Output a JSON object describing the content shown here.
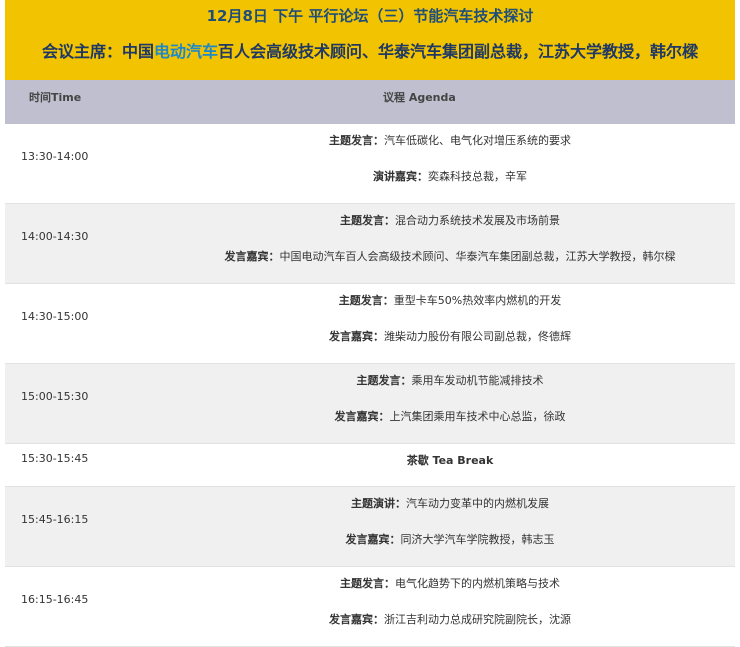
{
  "header": {
    "title": "12月8日 下午 平行论坛（三）节能汽车技术探讨",
    "chair_prefix": "会议主席：中国",
    "chair_highlight": "电动汽车",
    "chair_suffix": "百人会高级技术顾问、华泰汽车集团副总裁，江苏大学教授，韩尔樑"
  },
  "columns": {
    "time": "时间Time",
    "agenda": "议程 Agenda"
  },
  "sessions": [
    {
      "time": "13:30-14:00",
      "topic_label": "主题发言：",
      "topic": "汽车低碳化、电气化对增压系统的要求",
      "speaker_label": "演讲嘉宾：",
      "speaker": "奕森科技总裁，辛军"
    },
    {
      "time": "14:00-14:30",
      "topic_label": "主题发言：",
      "topic": "混合动力系统技术发展及市场前景",
      "speaker_label": "发言嘉宾：",
      "speaker": "中国电动汽车百人会高级技术顾问、华泰汽车集团副总裁，江苏大学教授，韩尔樑"
    },
    {
      "time": "14:30-15:00",
      "topic_label": "主题发言：",
      "topic": "重型卡车50%热效率内燃机的开发",
      "speaker_label": "发言嘉宾：",
      "speaker": "潍柴动力股份有限公司副总裁，佟德辉"
    },
    {
      "time": "15:00-15:30",
      "topic_label": "主题发言：",
      "topic": "乘用车发动机节能减排技术",
      "speaker_label": "发言嘉宾：",
      "speaker": "上汽集团乘用车技术中心总监，徐政"
    },
    {
      "time": "15:30-15:45",
      "break": "茶歇 Tea Break"
    },
    {
      "time": "15:45-16:15",
      "topic_label": "主题演讲：",
      "topic": "汽车动力变革中的内燃机发展",
      "speaker_label": "发言嘉宾：",
      "speaker": "同济大学汽车学院教授，韩志玉"
    },
    {
      "time": "16:15-16:45",
      "topic_label": "主题发言：",
      "topic": "电气化趋势下的内燃机策略与技术",
      "speaker_label": "发言嘉宾：",
      "speaker": "浙江吉利动力总成研究院副院长，沈源"
    }
  ]
}
